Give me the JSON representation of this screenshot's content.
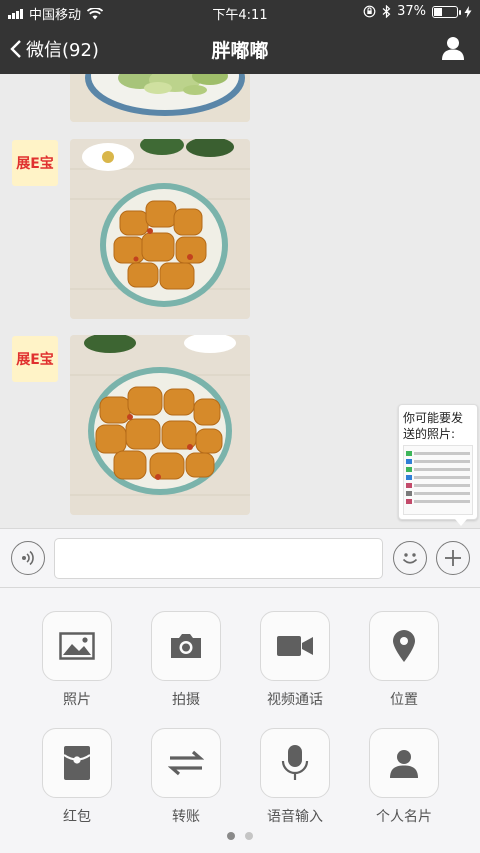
{
  "status_bar": {
    "carrier": "中国移动",
    "time": "下午4:11",
    "battery_percent": "37%",
    "battery_level": 0.37,
    "icons": [
      "signal-icon",
      "wifi-icon",
      "lock-rotation-icon",
      "bluetooth-icon",
      "battery-icon",
      "charging-icon"
    ]
  },
  "nav": {
    "back_label": "微信(92)",
    "title": "胖嘟嘟",
    "right_icon": "user-icon"
  },
  "chat": {
    "messages": [
      {
        "sender_avatar": "展E宝",
        "type": "image",
        "content": "food-photo-cucumber"
      },
      {
        "sender_avatar": "展E宝",
        "type": "image",
        "content": "food-photo-tofu"
      },
      {
        "sender_avatar": "展E宝",
        "type": "image",
        "content": "food-photo-tofu-2"
      }
    ],
    "suggestion_text": "你可能要发送的照片:"
  },
  "input_bar": {
    "voice_icon": "voice-icon",
    "emoji_icon": "emoji-icon",
    "plus_icon": "plus-icon",
    "text_value": ""
  },
  "tools": [
    {
      "label": "照片",
      "icon": "image-icon"
    },
    {
      "label": "拍摄",
      "icon": "camera-icon"
    },
    {
      "label": "视频通话",
      "icon": "video-call-icon"
    },
    {
      "label": "位置",
      "icon": "location-icon"
    },
    {
      "label": "红包",
      "icon": "red-packet-icon"
    },
    {
      "label": "转账",
      "icon": "transfer-icon"
    },
    {
      "label": "语音输入",
      "icon": "microphone-icon"
    },
    {
      "label": "个人名片",
      "icon": "contact-card-icon"
    }
  ],
  "pager": {
    "current_page": 1,
    "total_pages": 2
  },
  "colors": {
    "header_bg": "#343434",
    "chat_bg": "#ebebeb",
    "panel_bg": "#f5f5f7",
    "icon_gray": "#5f5f5f",
    "avatar_red": "#e0312f"
  }
}
